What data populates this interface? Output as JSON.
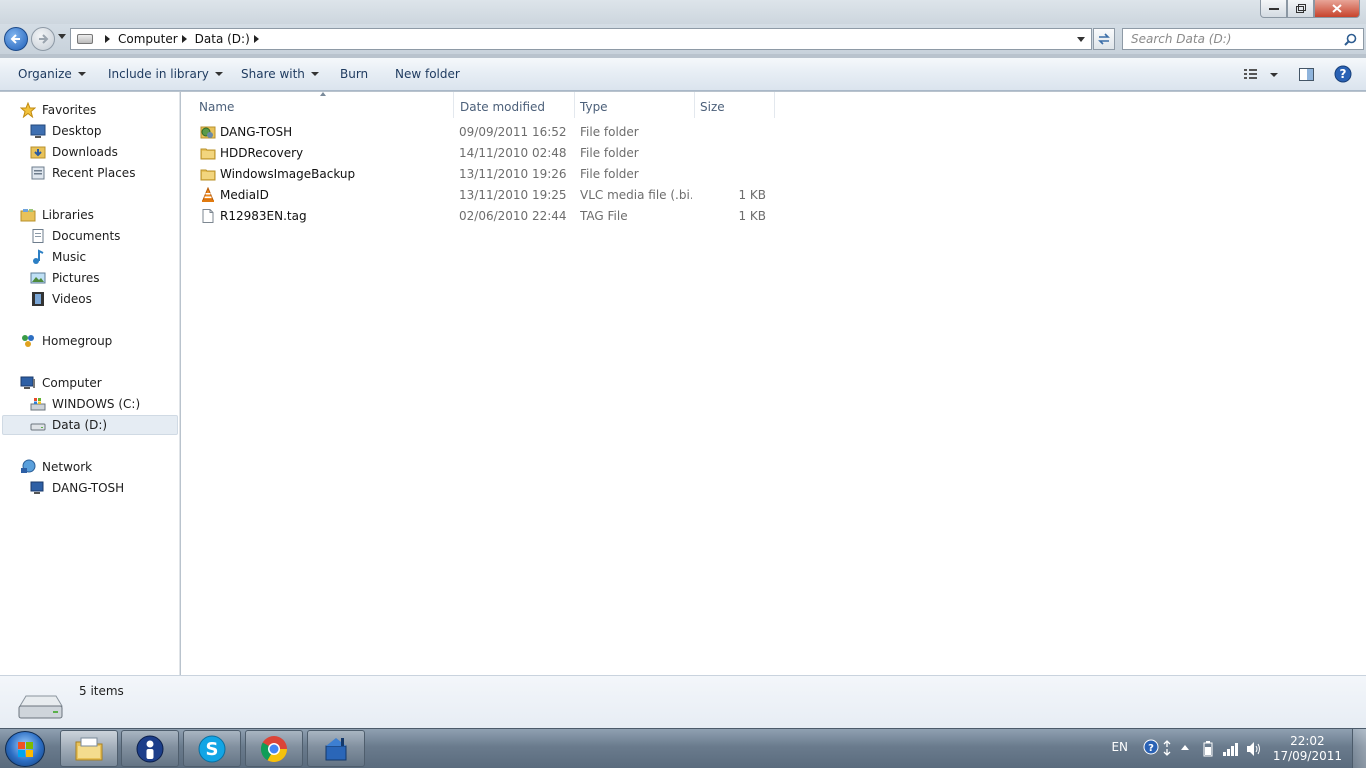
{
  "address": {
    "crumbs": [
      "Computer",
      "Data (D:)"
    ]
  },
  "search": {
    "placeholder": "Search Data (D:)"
  },
  "toolbar": {
    "organize": "Organize",
    "include_in_library": "Include in library",
    "share_with": "Share with",
    "burn": "Burn",
    "new_folder": "New folder"
  },
  "sidebar": {
    "favorites": {
      "label": "Favorites",
      "items": [
        "Desktop",
        "Downloads",
        "Recent Places"
      ]
    },
    "libraries": {
      "label": "Libraries",
      "items": [
        "Documents",
        "Music",
        "Pictures",
        "Videos"
      ]
    },
    "homegroup": {
      "label": "Homegroup"
    },
    "computer": {
      "label": "Computer",
      "items": [
        "WINDOWS (C:)",
        "Data (D:)"
      ],
      "selected": "Data (D:)"
    },
    "network": {
      "label": "Network",
      "items": [
        "DANG-TOSH"
      ]
    }
  },
  "columns": {
    "name": "Name",
    "date": "Date modified",
    "type": "Type",
    "size": "Size"
  },
  "files": [
    {
      "name": "DANG-TOSH",
      "date": "09/09/2011 16:52",
      "type": "File folder",
      "size": "",
      "icon": "shared-folder-icon"
    },
    {
      "name": "HDDRecovery",
      "date": "14/11/2010 02:48",
      "type": "File folder",
      "size": "",
      "icon": "folder-icon"
    },
    {
      "name": "WindowsImageBackup",
      "date": "13/11/2010 19:26",
      "type": "File folder",
      "size": "",
      "icon": "folder-icon"
    },
    {
      "name": "MediaID",
      "date": "13/11/2010 19:25",
      "type": "VLC media file (.bi...",
      "size": "1 KB",
      "icon": "vlc-icon"
    },
    {
      "name": "R12983EN.tag",
      "date": "02/06/2010 22:44",
      "type": "TAG File",
      "size": "1 KB",
      "icon": "file-icon"
    }
  ],
  "details": {
    "count": "5 items"
  },
  "taskbar": {
    "lang": "EN",
    "time": "22:02",
    "date": "17/09/2011",
    "apps": [
      "windows-explorer",
      "user-app",
      "skype",
      "chrome",
      "remote-app"
    ]
  },
  "colors": {
    "folder": "#e8c25a",
    "accent": "#1e3a5f",
    "selection": "#e5ecf3"
  }
}
